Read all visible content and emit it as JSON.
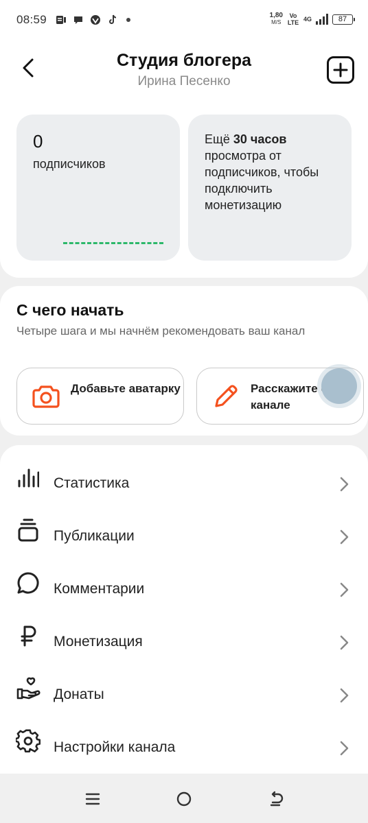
{
  "status_bar": {
    "time": "08:59",
    "net_speed": "1,80",
    "net_speed_unit": "M/S",
    "volte": "Vo LTE",
    "network": "4G",
    "battery": "87"
  },
  "header": {
    "title": "Студия блогера",
    "subtitle": "Ирина Песенко"
  },
  "stats": {
    "subscribers_count": "0",
    "subscribers_label": "подписчиков",
    "monetization_prefix": "Ещё",
    "monetization_hours": "30 часов",
    "monetization_rest": "просмотра от подписчиков, чтобы подключить монетизацию"
  },
  "start": {
    "title": "С чего начать",
    "description": "Четыре шага и мы начнём рекомендовать ваш канал",
    "steps": [
      {
        "label": "Добавьте аватарку",
        "icon": "camera-icon"
      },
      {
        "label": "Расскажите о канале",
        "icon": "pencil-icon"
      }
    ]
  },
  "menu": {
    "items": [
      {
        "label": "Статистика",
        "icon": "bar-chart-icon"
      },
      {
        "label": "Публикации",
        "icon": "stack-icon"
      },
      {
        "label": "Комментарии",
        "icon": "comment-icon"
      },
      {
        "label": "Монетизация",
        "icon": "ruble-icon"
      },
      {
        "label": "Донаты",
        "icon": "donate-hand-icon"
      },
      {
        "label": "Настройки канала",
        "icon": "gear-icon"
      }
    ]
  },
  "colors": {
    "accent_orange": "#f4511e",
    "progress_green": "#2db86a",
    "card_bg": "#eceef0"
  }
}
